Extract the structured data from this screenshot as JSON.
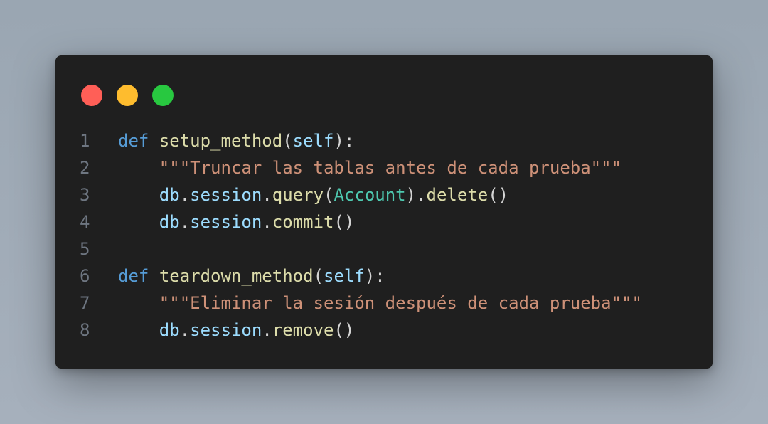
{
  "window": {
    "controls": [
      {
        "name": "close",
        "color": "#ff5f57"
      },
      {
        "name": "minimize",
        "color": "#febc2e"
      },
      {
        "name": "maximize",
        "color": "#28c840"
      }
    ]
  },
  "code": {
    "lines": [
      {
        "number": "1",
        "tokens": [
          {
            "t": "def",
            "c": "kw"
          },
          {
            "t": " ",
            "c": "pun"
          },
          {
            "t": "setup_method",
            "c": "fn"
          },
          {
            "t": "(",
            "c": "pun"
          },
          {
            "t": "self",
            "c": "var"
          },
          {
            "t": "):",
            "c": "pun"
          }
        ]
      },
      {
        "number": "2",
        "tokens": [
          {
            "t": "    ",
            "c": "pun"
          },
          {
            "t": "\"\"\"Truncar las tablas antes de cada prueba\"\"\"",
            "c": "str"
          }
        ]
      },
      {
        "number": "3",
        "tokens": [
          {
            "t": "    ",
            "c": "pun"
          },
          {
            "t": "db",
            "c": "var"
          },
          {
            "t": ".",
            "c": "pun"
          },
          {
            "t": "session",
            "c": "var"
          },
          {
            "t": ".",
            "c": "pun"
          },
          {
            "t": "query",
            "c": "fn"
          },
          {
            "t": "(",
            "c": "pun"
          },
          {
            "t": "Account",
            "c": "cls"
          },
          {
            "t": ").",
            "c": "pun"
          },
          {
            "t": "delete",
            "c": "fn"
          },
          {
            "t": "()",
            "c": "pun"
          }
        ]
      },
      {
        "number": "4",
        "tokens": [
          {
            "t": "    ",
            "c": "pun"
          },
          {
            "t": "db",
            "c": "var"
          },
          {
            "t": ".",
            "c": "pun"
          },
          {
            "t": "session",
            "c": "var"
          },
          {
            "t": ".",
            "c": "pun"
          },
          {
            "t": "commit",
            "c": "fn"
          },
          {
            "t": "()",
            "c": "pun"
          }
        ]
      },
      {
        "number": "5",
        "tokens": []
      },
      {
        "number": "6",
        "tokens": [
          {
            "t": "def",
            "c": "kw"
          },
          {
            "t": " ",
            "c": "pun"
          },
          {
            "t": "teardown_method",
            "c": "fn"
          },
          {
            "t": "(",
            "c": "pun"
          },
          {
            "t": "self",
            "c": "var"
          },
          {
            "t": "):",
            "c": "pun"
          }
        ]
      },
      {
        "number": "7",
        "tokens": [
          {
            "t": "    ",
            "c": "pun"
          },
          {
            "t": "\"\"\"Eliminar la sesión después de cada prueba\"\"\"",
            "c": "str"
          }
        ]
      },
      {
        "number": "8",
        "tokens": [
          {
            "t": "    ",
            "c": "pun"
          },
          {
            "t": "db",
            "c": "var"
          },
          {
            "t": ".",
            "c": "pun"
          },
          {
            "t": "session",
            "c": "var"
          },
          {
            "t": ".",
            "c": "pun"
          },
          {
            "t": "remove",
            "c": "fn"
          },
          {
            "t": "()",
            "c": "pun"
          }
        ]
      }
    ]
  },
  "colors": {
    "background": "#1f1f1f",
    "keyword": "#569cd6",
    "function": "#dcdcaa",
    "variable": "#9cdcfe",
    "class": "#4ec9b0",
    "string": "#ce9178",
    "line_number": "#6e7681"
  }
}
